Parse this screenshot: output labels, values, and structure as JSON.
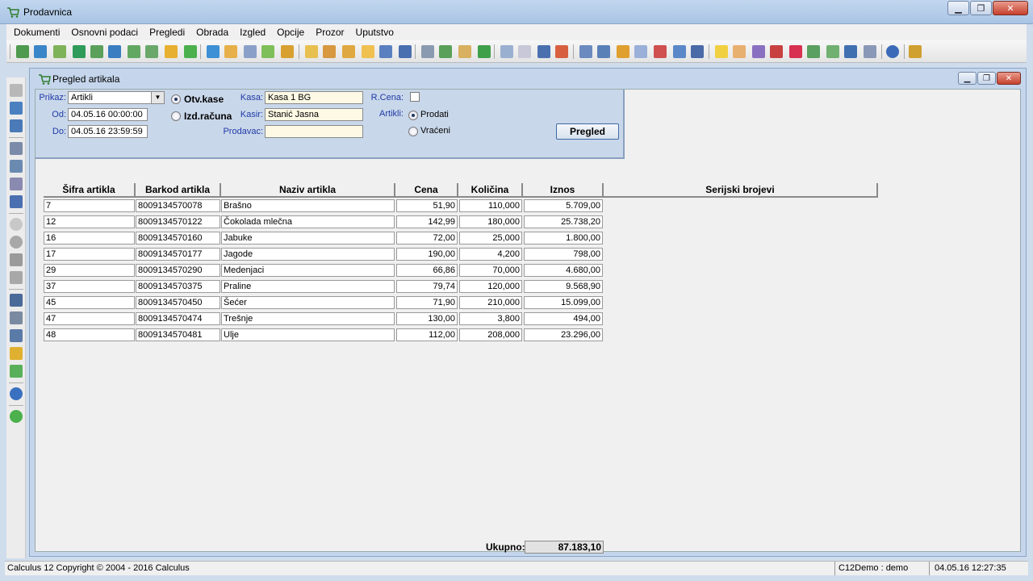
{
  "window": {
    "title": "Prodavnica"
  },
  "menu": [
    "Dokumenti",
    "Osnovni podaci",
    "Pregledi",
    "Obrada",
    "Izgled",
    "Opcije",
    "Prozor",
    "Uputstvo"
  ],
  "child": {
    "title": "Pregled artikala"
  },
  "filters": {
    "prikaz_label": "Prikaz:",
    "prikaz_value": "Artikli",
    "od_label": "Od:",
    "od_value": "04.05.16 00:00:00",
    "do_label": "Do:",
    "do_value": "04.05.16 23:59:59",
    "otv_kase": "Otv.kase",
    "izd_racuna": "Izd.računa",
    "kasa_label": "Kasa:",
    "kasa_value": "Kasa 1 BG",
    "kasir_label": "Kasir:",
    "kasir_value": "Stanić Jasna",
    "prodavac_label": "Prodavac:",
    "prodavac_value": "",
    "rcena_label": "R.Cena:",
    "artikli_label": "Artikli:",
    "prodati": "Prodati",
    "vraceni": "Vraćeni",
    "pregled_button": "Pregled"
  },
  "table": {
    "columns": [
      "Šifra artikla",
      "Barkod artikla",
      "Naziv artikla",
      "Cena",
      "Količina",
      "Iznos",
      "Serijski brojevi"
    ],
    "rows": [
      [
        "7",
        "8009134570078",
        "Brašno",
        "51,90",
        "110,000",
        "5.709,00"
      ],
      [
        "12",
        "8009134570122",
        "Čokolada mlečna",
        "142,99",
        "180,000",
        "25.738,20"
      ],
      [
        "16",
        "8009134570160",
        "Jabuke",
        "72,00",
        "25,000",
        "1.800,00"
      ],
      [
        "17",
        "8009134570177",
        "Jagode",
        "190,00",
        "4,200",
        "798,00"
      ],
      [
        "29",
        "8009134570290",
        "Medenjaci",
        "66,86",
        "70,000",
        "4.680,00"
      ],
      [
        "37",
        "8009134570375",
        "Praline",
        "79,74",
        "120,000",
        "9.568,90"
      ],
      [
        "45",
        "8009134570450",
        "Šećer",
        "71,90",
        "210,000",
        "15.099,00"
      ],
      [
        "47",
        "8009134570474",
        "Trešnje",
        "130,00",
        "3,800",
        "494,00"
      ],
      [
        "48",
        "8009134570481",
        "Ulje",
        "112,00",
        "208,000",
        "23.296,00"
      ]
    ],
    "total_label": "Ukupno:",
    "total_value": "87.183,10"
  },
  "status": {
    "copyright": "Calculus 12  Copyright © 2004 - 2016  Calculus",
    "user": "C12Demo : demo",
    "datetime": "04.05.16 12:27:35"
  },
  "colors": {
    "label_blue": "#1f3aa6",
    "panel": "#c9d7ea",
    "field_yellow": "#fdf9e4"
  }
}
